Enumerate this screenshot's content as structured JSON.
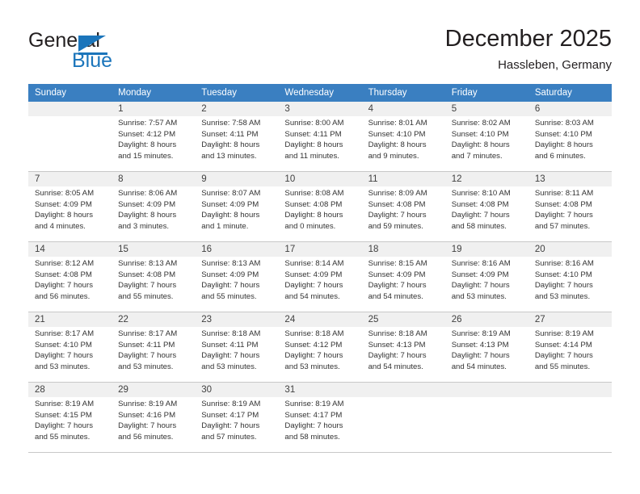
{
  "brand": {
    "name_part1": "General",
    "name_part2": "Blue",
    "logo_icon": "triangle-mark",
    "accent_color": "#1b75bb"
  },
  "header": {
    "title": "December 2025",
    "subtitle": "Hassleben, Germany"
  },
  "calendar": {
    "header_bg": "#3a7fc1",
    "daynum_bg": "#f0f0f0",
    "weekday_headers": [
      "Sunday",
      "Monday",
      "Tuesday",
      "Wednesday",
      "Thursday",
      "Friday",
      "Saturday"
    ],
    "weeks": [
      {
        "days": [
          {
            "num": "",
            "sunrise": "",
            "sunset": "",
            "daylight1": "",
            "daylight2": ""
          },
          {
            "num": "1",
            "sunrise": "Sunrise: 7:57 AM",
            "sunset": "Sunset: 4:12 PM",
            "daylight1": "Daylight: 8 hours",
            "daylight2": "and 15 minutes."
          },
          {
            "num": "2",
            "sunrise": "Sunrise: 7:58 AM",
            "sunset": "Sunset: 4:11 PM",
            "daylight1": "Daylight: 8 hours",
            "daylight2": "and 13 minutes."
          },
          {
            "num": "3",
            "sunrise": "Sunrise: 8:00 AM",
            "sunset": "Sunset: 4:11 PM",
            "daylight1": "Daylight: 8 hours",
            "daylight2": "and 11 minutes."
          },
          {
            "num": "4",
            "sunrise": "Sunrise: 8:01 AM",
            "sunset": "Sunset: 4:10 PM",
            "daylight1": "Daylight: 8 hours",
            "daylight2": "and 9 minutes."
          },
          {
            "num": "5",
            "sunrise": "Sunrise: 8:02 AM",
            "sunset": "Sunset: 4:10 PM",
            "daylight1": "Daylight: 8 hours",
            "daylight2": "and 7 minutes."
          },
          {
            "num": "6",
            "sunrise": "Sunrise: 8:03 AM",
            "sunset": "Sunset: 4:10 PM",
            "daylight1": "Daylight: 8 hours",
            "daylight2": "and 6 minutes."
          }
        ]
      },
      {
        "days": [
          {
            "num": "7",
            "sunrise": "Sunrise: 8:05 AM",
            "sunset": "Sunset: 4:09 PM",
            "daylight1": "Daylight: 8 hours",
            "daylight2": "and 4 minutes."
          },
          {
            "num": "8",
            "sunrise": "Sunrise: 8:06 AM",
            "sunset": "Sunset: 4:09 PM",
            "daylight1": "Daylight: 8 hours",
            "daylight2": "and 3 minutes."
          },
          {
            "num": "9",
            "sunrise": "Sunrise: 8:07 AM",
            "sunset": "Sunset: 4:09 PM",
            "daylight1": "Daylight: 8 hours",
            "daylight2": "and 1 minute."
          },
          {
            "num": "10",
            "sunrise": "Sunrise: 8:08 AM",
            "sunset": "Sunset: 4:08 PM",
            "daylight1": "Daylight: 8 hours",
            "daylight2": "and 0 minutes."
          },
          {
            "num": "11",
            "sunrise": "Sunrise: 8:09 AM",
            "sunset": "Sunset: 4:08 PM",
            "daylight1": "Daylight: 7 hours",
            "daylight2": "and 59 minutes."
          },
          {
            "num": "12",
            "sunrise": "Sunrise: 8:10 AM",
            "sunset": "Sunset: 4:08 PM",
            "daylight1": "Daylight: 7 hours",
            "daylight2": "and 58 minutes."
          },
          {
            "num": "13",
            "sunrise": "Sunrise: 8:11 AM",
            "sunset": "Sunset: 4:08 PM",
            "daylight1": "Daylight: 7 hours",
            "daylight2": "and 57 minutes."
          }
        ]
      },
      {
        "days": [
          {
            "num": "14",
            "sunrise": "Sunrise: 8:12 AM",
            "sunset": "Sunset: 4:08 PM",
            "daylight1": "Daylight: 7 hours",
            "daylight2": "and 56 minutes."
          },
          {
            "num": "15",
            "sunrise": "Sunrise: 8:13 AM",
            "sunset": "Sunset: 4:08 PM",
            "daylight1": "Daylight: 7 hours",
            "daylight2": "and 55 minutes."
          },
          {
            "num": "16",
            "sunrise": "Sunrise: 8:13 AM",
            "sunset": "Sunset: 4:09 PM",
            "daylight1": "Daylight: 7 hours",
            "daylight2": "and 55 minutes."
          },
          {
            "num": "17",
            "sunrise": "Sunrise: 8:14 AM",
            "sunset": "Sunset: 4:09 PM",
            "daylight1": "Daylight: 7 hours",
            "daylight2": "and 54 minutes."
          },
          {
            "num": "18",
            "sunrise": "Sunrise: 8:15 AM",
            "sunset": "Sunset: 4:09 PM",
            "daylight1": "Daylight: 7 hours",
            "daylight2": "and 54 minutes."
          },
          {
            "num": "19",
            "sunrise": "Sunrise: 8:16 AM",
            "sunset": "Sunset: 4:09 PM",
            "daylight1": "Daylight: 7 hours",
            "daylight2": "and 53 minutes."
          },
          {
            "num": "20",
            "sunrise": "Sunrise: 8:16 AM",
            "sunset": "Sunset: 4:10 PM",
            "daylight1": "Daylight: 7 hours",
            "daylight2": "and 53 minutes."
          }
        ]
      },
      {
        "days": [
          {
            "num": "21",
            "sunrise": "Sunrise: 8:17 AM",
            "sunset": "Sunset: 4:10 PM",
            "daylight1": "Daylight: 7 hours",
            "daylight2": "and 53 minutes."
          },
          {
            "num": "22",
            "sunrise": "Sunrise: 8:17 AM",
            "sunset": "Sunset: 4:11 PM",
            "daylight1": "Daylight: 7 hours",
            "daylight2": "and 53 minutes."
          },
          {
            "num": "23",
            "sunrise": "Sunrise: 8:18 AM",
            "sunset": "Sunset: 4:11 PM",
            "daylight1": "Daylight: 7 hours",
            "daylight2": "and 53 minutes."
          },
          {
            "num": "24",
            "sunrise": "Sunrise: 8:18 AM",
            "sunset": "Sunset: 4:12 PM",
            "daylight1": "Daylight: 7 hours",
            "daylight2": "and 53 minutes."
          },
          {
            "num": "25",
            "sunrise": "Sunrise: 8:18 AM",
            "sunset": "Sunset: 4:13 PM",
            "daylight1": "Daylight: 7 hours",
            "daylight2": "and 54 minutes."
          },
          {
            "num": "26",
            "sunrise": "Sunrise: 8:19 AM",
            "sunset": "Sunset: 4:13 PM",
            "daylight1": "Daylight: 7 hours",
            "daylight2": "and 54 minutes."
          },
          {
            "num": "27",
            "sunrise": "Sunrise: 8:19 AM",
            "sunset": "Sunset: 4:14 PM",
            "daylight1": "Daylight: 7 hours",
            "daylight2": "and 55 minutes."
          }
        ]
      },
      {
        "days": [
          {
            "num": "28",
            "sunrise": "Sunrise: 8:19 AM",
            "sunset": "Sunset: 4:15 PM",
            "daylight1": "Daylight: 7 hours",
            "daylight2": "and 55 minutes."
          },
          {
            "num": "29",
            "sunrise": "Sunrise: 8:19 AM",
            "sunset": "Sunset: 4:16 PM",
            "daylight1": "Daylight: 7 hours",
            "daylight2": "and 56 minutes."
          },
          {
            "num": "30",
            "sunrise": "Sunrise: 8:19 AM",
            "sunset": "Sunset: 4:17 PM",
            "daylight1": "Daylight: 7 hours",
            "daylight2": "and 57 minutes."
          },
          {
            "num": "31",
            "sunrise": "Sunrise: 8:19 AM",
            "sunset": "Sunset: 4:17 PM",
            "daylight1": "Daylight: 7 hours",
            "daylight2": "and 58 minutes."
          },
          {
            "num": "",
            "sunrise": "",
            "sunset": "",
            "daylight1": "",
            "daylight2": ""
          },
          {
            "num": "",
            "sunrise": "",
            "sunset": "",
            "daylight1": "",
            "daylight2": ""
          },
          {
            "num": "",
            "sunrise": "",
            "sunset": "",
            "daylight1": "",
            "daylight2": ""
          }
        ]
      }
    ]
  }
}
